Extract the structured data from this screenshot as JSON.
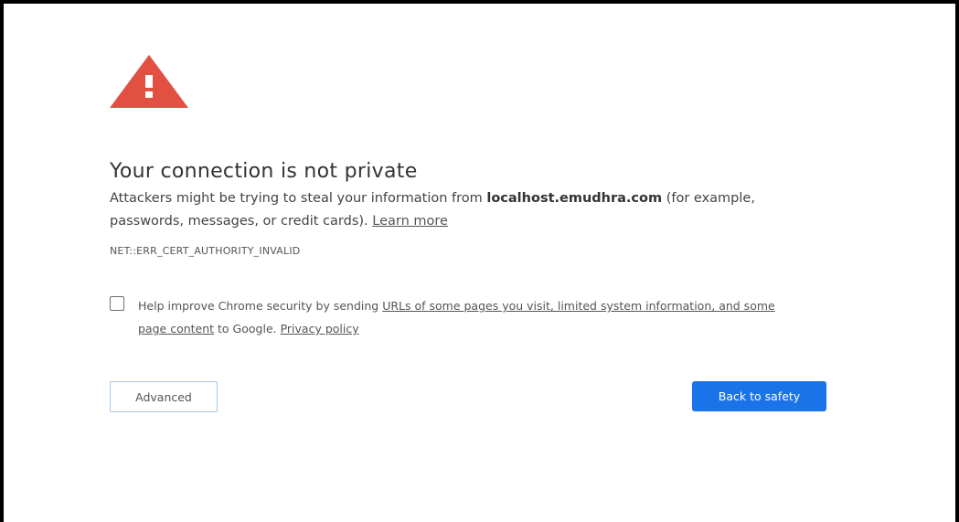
{
  "page": {
    "title": "Your connection is not private",
    "description": {
      "prefix": "Attackers might be trying to steal your information from ",
      "host": "localhost.emudhra.com",
      "suffix": " (for example, passwords, messages, or credit cards). ",
      "learn_more": "Learn more"
    },
    "error_code": "NET::ERR_CERT_AUTHORITY_INVALID",
    "optin": {
      "checked": false,
      "prefix": "Help improve Chrome security by sending ",
      "link_text": "URLs of some pages you visit, limited system information, and some page content",
      "middle": " to Google. ",
      "privacy_link": "Privacy policy"
    },
    "buttons": {
      "advanced": "Advanced",
      "back_to_safety": "Back to safety"
    }
  },
  "colors": {
    "warning_red": "#e25041",
    "primary_blue": "#1a73e8",
    "advanced_border": "#a8c4e8"
  },
  "icons": {
    "warning": "warning-triangle-icon"
  }
}
